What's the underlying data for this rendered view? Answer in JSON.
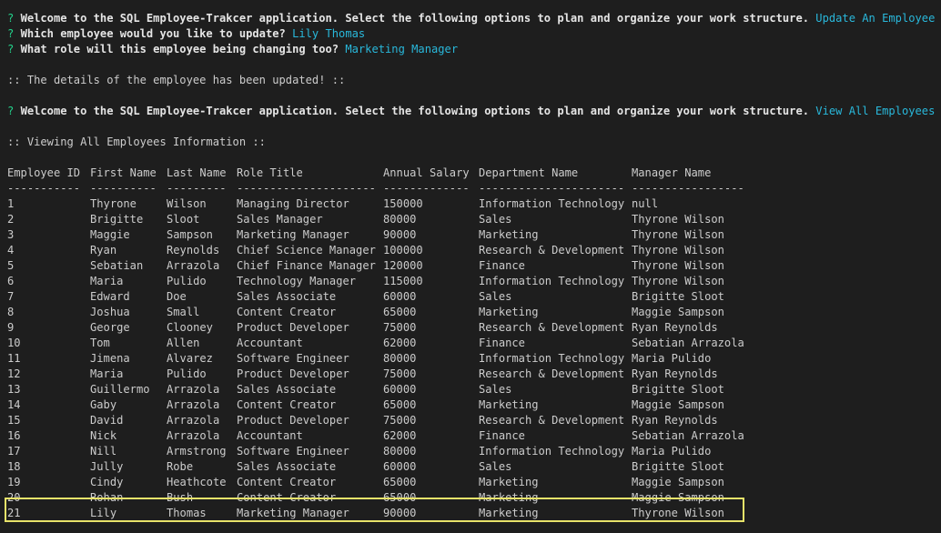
{
  "prompt_symbol": "?",
  "lines": {
    "welcome_1": "Welcome to the SQL Employee-Trakcer application. Select the following options to plan and organize your work structure.",
    "choice_1": "Update An Employee Role",
    "q_employee": "Which employee would you like to update?",
    "a_employee": "Lily Thomas",
    "q_role": "What role will this employee being changing too?",
    "a_role": "Marketing Manager",
    "updated_msg": ":: The details of the employee has been updated! ::",
    "welcome_2": "Welcome to the SQL Employee-Trakcer application. Select the following options to plan and organize your work structure.",
    "choice_2": "View All Employees",
    "viewing_msg": ":: Viewing All Employees Information ::"
  },
  "table": {
    "headers": [
      "Employee ID",
      "First Name",
      "Last Name",
      "Role Title",
      "Annual Salary",
      "Department Name",
      "Manager Name"
    ],
    "separators": [
      "-----------",
      "----------",
      "---------",
      "---------------------",
      "-------------",
      "----------------------",
      "-----------------"
    ],
    "rows": [
      [
        "1",
        "Thyrone",
        "Wilson",
        "Managing Director",
        "150000",
        "Information Technology",
        "null"
      ],
      [
        "2",
        "Brigitte",
        "Sloot",
        "Sales Manager",
        "80000",
        "Sales",
        "Thyrone Wilson"
      ],
      [
        "3",
        "Maggie",
        "Sampson",
        "Marketing Manager",
        "90000",
        "Marketing",
        "Thyrone Wilson"
      ],
      [
        "4",
        "Ryan",
        "Reynolds",
        "Chief Science Manager",
        "100000",
        "Research & Development",
        "Thyrone Wilson"
      ],
      [
        "5",
        "Sebatian",
        "Arrazola",
        "Chief Finance Manager",
        "120000",
        "Finance",
        "Thyrone Wilson"
      ],
      [
        "6",
        "Maria",
        "Pulido",
        "Technology Manager",
        "115000",
        "Information Technology",
        "Thyrone Wilson"
      ],
      [
        "7",
        "Edward",
        "Doe",
        "Sales Associate",
        "60000",
        "Sales",
        "Brigitte Sloot"
      ],
      [
        "8",
        "Joshua",
        "Small",
        "Content Creator",
        "65000",
        "Marketing",
        "Maggie Sampson"
      ],
      [
        "9",
        "George",
        "Clooney",
        "Product Developer",
        "75000",
        "Research & Development",
        "Ryan Reynolds"
      ],
      [
        "10",
        "Tom",
        "Allen",
        "Accountant",
        "62000",
        "Finance",
        "Sebatian Arrazola"
      ],
      [
        "11",
        "Jimena",
        "Alvarez",
        "Software Engineer",
        "80000",
        "Information Technology",
        "Maria Pulido"
      ],
      [
        "12",
        "Maria",
        "Pulido",
        "Product Developer",
        "75000",
        "Research & Development",
        "Ryan Reynolds"
      ],
      [
        "13",
        "Guillermo",
        "Arrazola",
        "Sales Associate",
        "60000",
        "Sales",
        "Brigitte Sloot"
      ],
      [
        "14",
        "Gaby",
        "Arrazola",
        "Content Creator",
        "65000",
        "Marketing",
        "Maggie Sampson"
      ],
      [
        "15",
        "David",
        "Arrazola",
        "Product Developer",
        "75000",
        "Research & Development",
        "Ryan Reynolds"
      ],
      [
        "16",
        "Nick",
        "Arrazola",
        "Accountant",
        "62000",
        "Finance",
        "Sebatian Arrazola"
      ],
      [
        "17",
        "Nill",
        "Armstrong",
        "Software Engineer",
        "80000",
        "Information Technology",
        "Maria Pulido"
      ],
      [
        "18",
        "Jully",
        "Robe",
        "Sales Associate",
        "60000",
        "Sales",
        "Brigitte Sloot"
      ],
      [
        "19",
        "Cindy",
        "Heathcote",
        "Content Creator",
        "65000",
        "Marketing",
        "Maggie Sampson"
      ],
      [
        "20",
        "Rohan",
        "Bush",
        "Content Creator",
        "65000",
        "Marketing",
        "Maggie Sampson"
      ],
      [
        "21",
        "Lily",
        "Thomas",
        "Marketing Manager",
        "90000",
        "Marketing",
        "Thyrone Wilson"
      ]
    ]
  },
  "colors": {
    "background": "#1e1e1e",
    "text": "#cccccc",
    "prompt": "#23d18b",
    "answer": "#29b8db",
    "highlight_border": "#e8e36a"
  }
}
